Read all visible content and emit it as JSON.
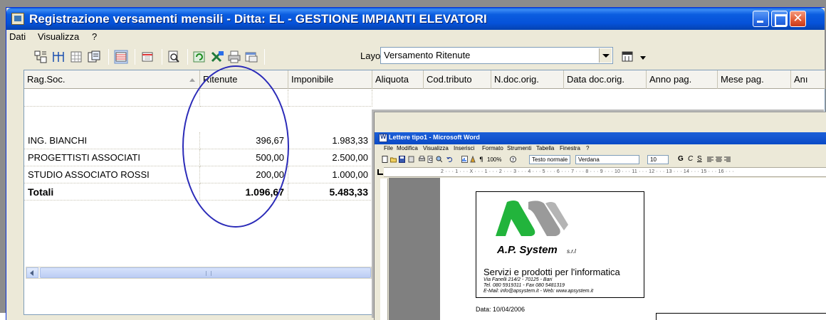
{
  "window": {
    "title": "Registrazione versamenti mensili  - Ditta: EL - GESTIONE IMPIANTI ELEVATORI",
    "close_glyph": "✕"
  },
  "menu": {
    "dati": "Dati",
    "visualizza": "Visualizza",
    "help": "?"
  },
  "toolbar": {
    "layout_label": "Layout:",
    "layout_value": "Versamento Ritenute",
    "icons": [
      "tree-icon",
      "columns-icon",
      "grid-icon",
      "export-icon",
      "highlight-icon",
      "form-icon",
      "preview-icon",
      "refresh-icon",
      "excel-icon",
      "print-icon",
      "window-icon"
    ]
  },
  "grid": {
    "columns": [
      "Rag.Soc.",
      "Ritenute",
      "Imponibile",
      "Aliquota",
      "Cod.tributo",
      "N.doc.orig.",
      "Data doc.orig.",
      "Anno pag.",
      "Mese pag.",
      "Anı"
    ],
    "rows": [
      {
        "rag_soc": "ING. BIANCHI",
        "ritenute": "396,67",
        "imponibile": "1.983,33"
      },
      {
        "rag_soc": "PROGETTISTI ASSOCIATI",
        "ritenute": "500,00",
        "imponibile": "2.500,00"
      },
      {
        "rag_soc": "STUDIO ASSOCIATO ROSSI",
        "ritenute": "200,00",
        "imponibile": "1.000,00"
      }
    ],
    "total": {
      "label": "Totali",
      "ritenute": "1.096,67",
      "imponibile": "5.483,33"
    }
  },
  "word": {
    "title": "Lettere tipo1 - Microsoft Word",
    "menu": [
      "File",
      "Modifica",
      "Visualizza",
      "Inserisci",
      "Formato",
      "Strumenti",
      "Tabella",
      "Finestra",
      "?"
    ],
    "zoom": "100%",
    "style": "Testo normale",
    "font": "Verdana",
    "size": "10",
    "bold": "G",
    "italic": "C",
    "underline": "S",
    "ruler_marks": "2 · · · 1 · · · X · · · 1 · · · 2 · · · 3 · · · 4 · · · 5 · · · 6 · · · 7 · · · 8 · · · 9 · · · 10 · · · 11 · · · 12 · · · 13 · · · 14 · · · 15 · · · 16 · · ·",
    "letterhead": {
      "brand": "A.P. System",
      "srl": "s.r.l",
      "tagline": "Servizi e prodotti per l'informatica",
      "address": "Via Fanelli 214/2 - 70125 - Bari",
      "phone": "Tel. 080 5919311 - Fax 080 5481319",
      "email": "E-Mail: info@apsystem.it - Web: www.apsystem.it"
    },
    "date_line": "Data: 10/04/2006"
  },
  "colors": {
    "titlebar": "#0552d9",
    "ellipse": "#2b2bb8",
    "logo_green": "#22b43c",
    "logo_gray": "#9a9a9a"
  }
}
